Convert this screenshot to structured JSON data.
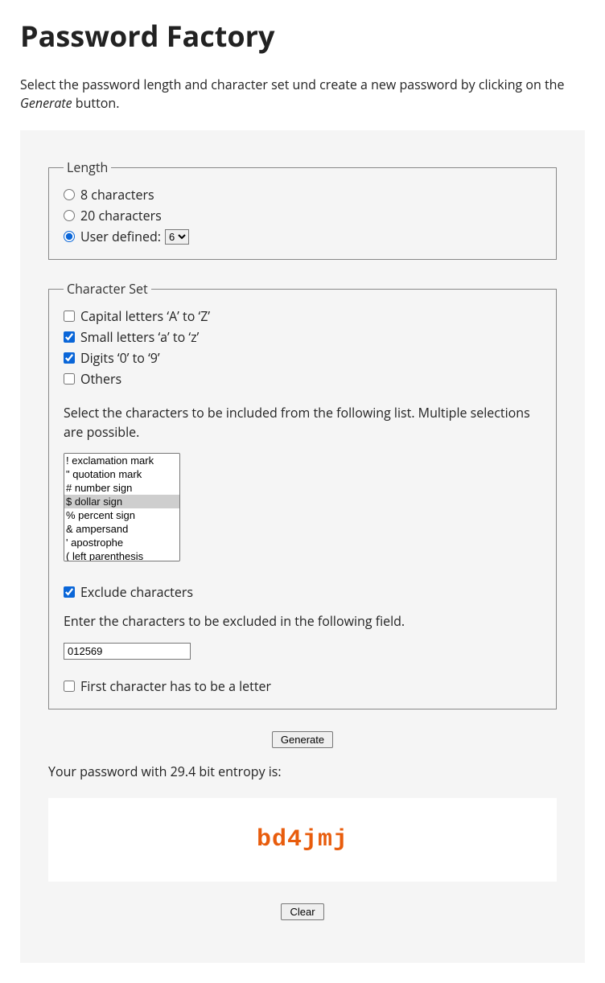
{
  "title": "Password Factory",
  "intro_pre": "Select the password length and character set und create a new password by clicking on the ",
  "intro_em": "Generate",
  "intro_post": " button.",
  "length": {
    "legend": "Length",
    "opt_8": "8 characters",
    "opt_20": "20 characters",
    "opt_user": "User defined: ",
    "user_value": "6",
    "selected": "user"
  },
  "charset": {
    "legend": "Character Set",
    "capital": {
      "label": "Capital letters ‘A’ to ‘Z’",
      "checked": false
    },
    "small": {
      "label": "Small letters ‘a’ to ‘z’",
      "checked": true
    },
    "digits": {
      "label": "Digits ‘0’ to ‘9’",
      "checked": true
    },
    "others": {
      "label": "Others",
      "checked": false
    },
    "help": "Select the characters to be included from the following list. Multiple selections are possible.",
    "list": [
      "! exclamation mark",
      "\" quotation mark",
      "# number sign",
      "$ dollar sign",
      "% percent sign",
      "& ampersand",
      "' apostrophe",
      "( left parenthesis"
    ],
    "list_selected": "$ dollar sign",
    "exclude": {
      "label": "Exclude characters",
      "checked": true
    },
    "exclude_help": "Enter the characters to be excluded in the following field.",
    "exclude_value": "012569",
    "first_letter": {
      "label": "First character has to be a letter",
      "checked": false
    }
  },
  "generate_button": "Generate",
  "result_label": "Your password with 29.4 bit entropy is:",
  "result_password": "bd4jmj",
  "clear_button": "Clear"
}
